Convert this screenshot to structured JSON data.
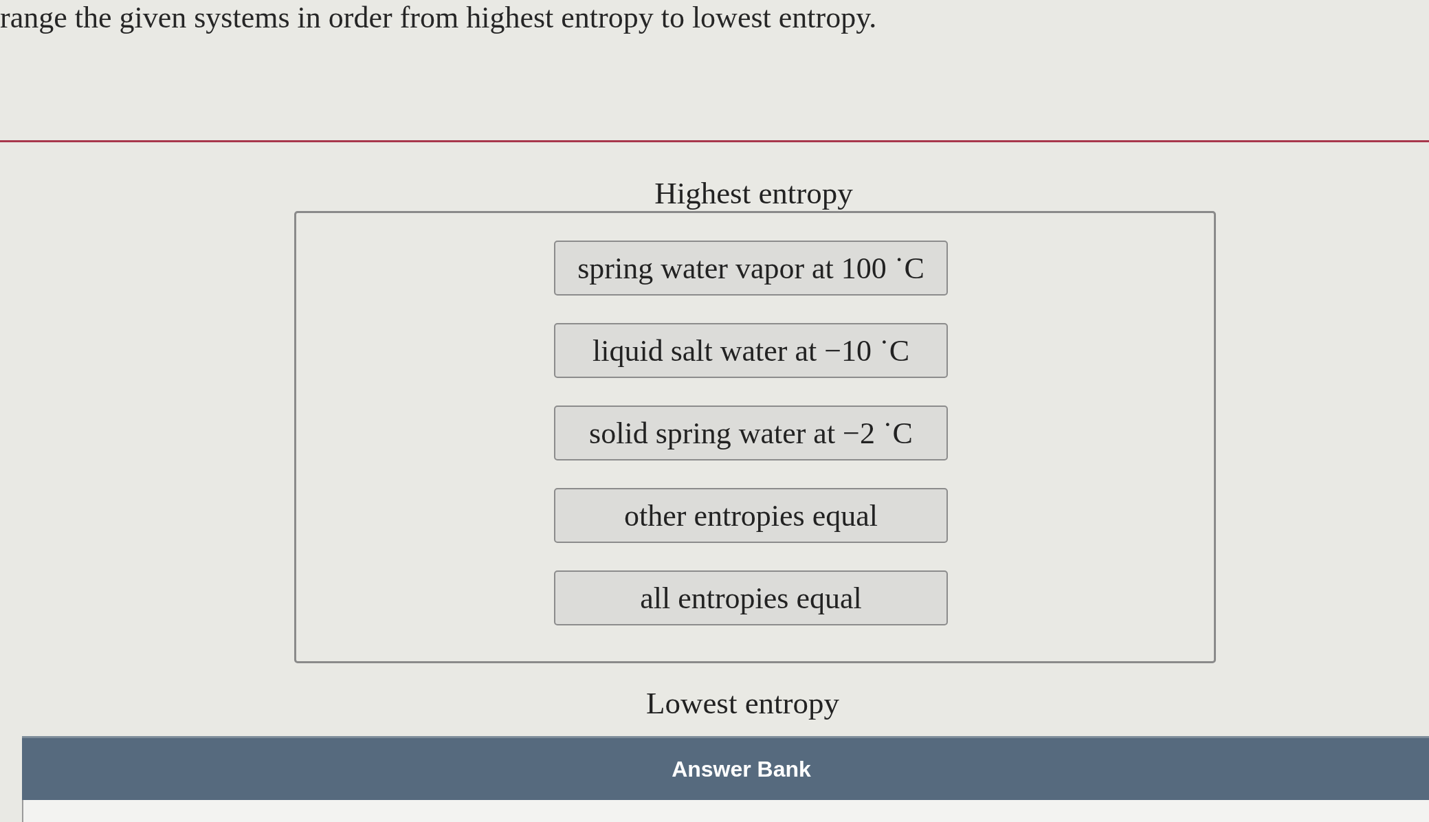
{
  "instruction": "range the given systems in order from highest entropy to lowest entropy.",
  "ranking": {
    "top_label": "Highest entropy",
    "items": [
      "spring water vapor at 100 ˙C",
      "liquid salt water at −10 ˙C",
      "solid spring water at −2 ˙C",
      "other entropies equal",
      "all entropies equal"
    ],
    "bottom_label": "Lowest entropy"
  },
  "answer_bank": {
    "title": "Answer Bank"
  }
}
